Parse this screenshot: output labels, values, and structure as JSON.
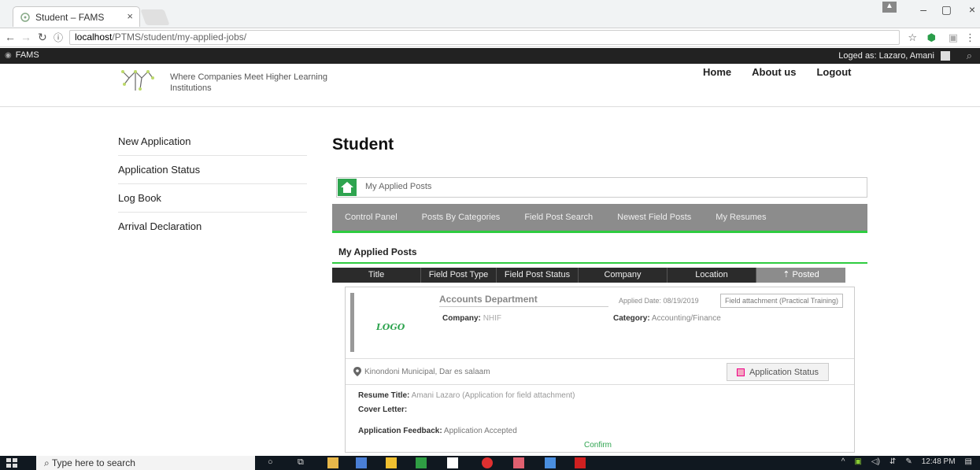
{
  "browser": {
    "tab_title": "Student – FAMS",
    "url_host": "localhost",
    "url_path": "/PTMS/student/my-applied-jobs/"
  },
  "fams_bar": {
    "brand": "FAMS",
    "logged_as": "Loged as: Lazaro, Amani"
  },
  "header": {
    "tagline": "Where Companies Meet Higher Learning Institutions",
    "nav": [
      "Home",
      "About us",
      "Logout"
    ]
  },
  "sidebar": {
    "items": [
      {
        "label": "New Application"
      },
      {
        "label": "Application Status"
      },
      {
        "label": "Log Book"
      },
      {
        "label": "Arrival Declaration"
      }
    ]
  },
  "main": {
    "title": "Student",
    "breadcrumb": "My Applied Posts",
    "menu": [
      "Control Panel",
      "Posts By Categories",
      "Field Post Search",
      "Newest Field Posts",
      "My Resumes"
    ],
    "section_title": "My Applied Posts",
    "columns": [
      "Title",
      "Field Post Type",
      "Field Post Status",
      "Company",
      "Location",
      "Posted"
    ]
  },
  "post": {
    "logo_text": "LOGO",
    "title": "Accounts Department",
    "applied_date": "Applied Date: 08/19/2019",
    "type_badge": "Field attachment (Practical Training)",
    "company_label": "Company:",
    "company": "NHIF",
    "category_label": "Category:",
    "category": "Accounting/Finance",
    "location": "Kinondoni Municipal, Dar es salaam",
    "status_button": "Application Status",
    "resume_label": "Resume Title:",
    "resume_value": "Amani Lazaro (Application for field attachment)",
    "cover_label": "Cover Letter:",
    "feedback_label": "Application Feedback:",
    "feedback_value": "Application Accepted",
    "confirm": "Confirm"
  },
  "taskbar": {
    "search_placeholder": "Type here to search",
    "time": "12:48 PM"
  },
  "colors": {
    "accent_green": "#2ecc40",
    "dark_bar": "#222222",
    "menu_gray": "#8c8c8c"
  }
}
